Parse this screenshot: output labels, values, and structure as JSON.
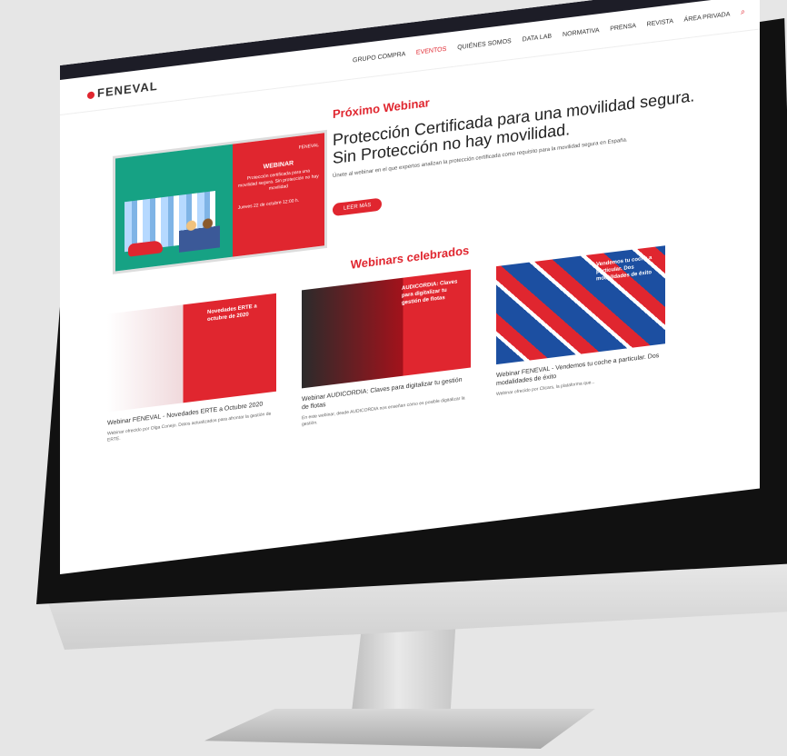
{
  "header": {
    "logo": "FENEVAL",
    "social": [
      "🐦",
      "in"
    ],
    "menu": [
      "GRUPO COMPRA",
      "EVENTOS",
      "QUIÉNES SOMOS",
      "DATA LAB",
      "NORMATIVA",
      "PRENSA",
      "REVISTA",
      "ÁREA PRIVADA"
    ]
  },
  "next_webinar": {
    "section_title": "Próximo Webinar",
    "headline": "Protección Certificada para una movilidad segura. Sin Protección no hay movilidad.",
    "description": "Únete al webinar en el que expertos analizan la protección certificada como requisito para la movilidad segura en España.",
    "button_label": "LEER MÁS",
    "banner": {
      "brand": "FENEVAL",
      "title": "WEBINAR",
      "text": "Protección certificada para una movilidad segura. Sin protección no hay movilidad",
      "date": "Jueves 22 de octubre 12:00 h."
    }
  },
  "past_webinars": {
    "section_title": "Webinars celebrados",
    "cards": [
      {
        "thumb_text": "Novedades ERTE a octubre de 2020",
        "title": "Webinar FENEVAL - Novedades ERTE a Octubre 2020",
        "description": "Webinar ofrecido por Olga Conejo. Datos actualizados para afrontar la gestión de ERTE."
      },
      {
        "thumb_text": "AUDICORDIA: Claves para digitalizar tu gestión de flotas",
        "title": "Webinar AUDICORDIA: Claves para digitalizar tu gestión de flotas",
        "description": "En este webinar, desde AUDICORDIA nos enseñan cómo es posible digitalizar la gestión."
      },
      {
        "thumb_text": "Vendemos tu coche a particular. Dos modalidades de éxito",
        "title": "Webinar FENEVAL - Vendemos tu coche a particular. Dos modalidades de éxito",
        "description": "Webinar ofrecido por Clicars, la plataforma que..."
      }
    ]
  }
}
